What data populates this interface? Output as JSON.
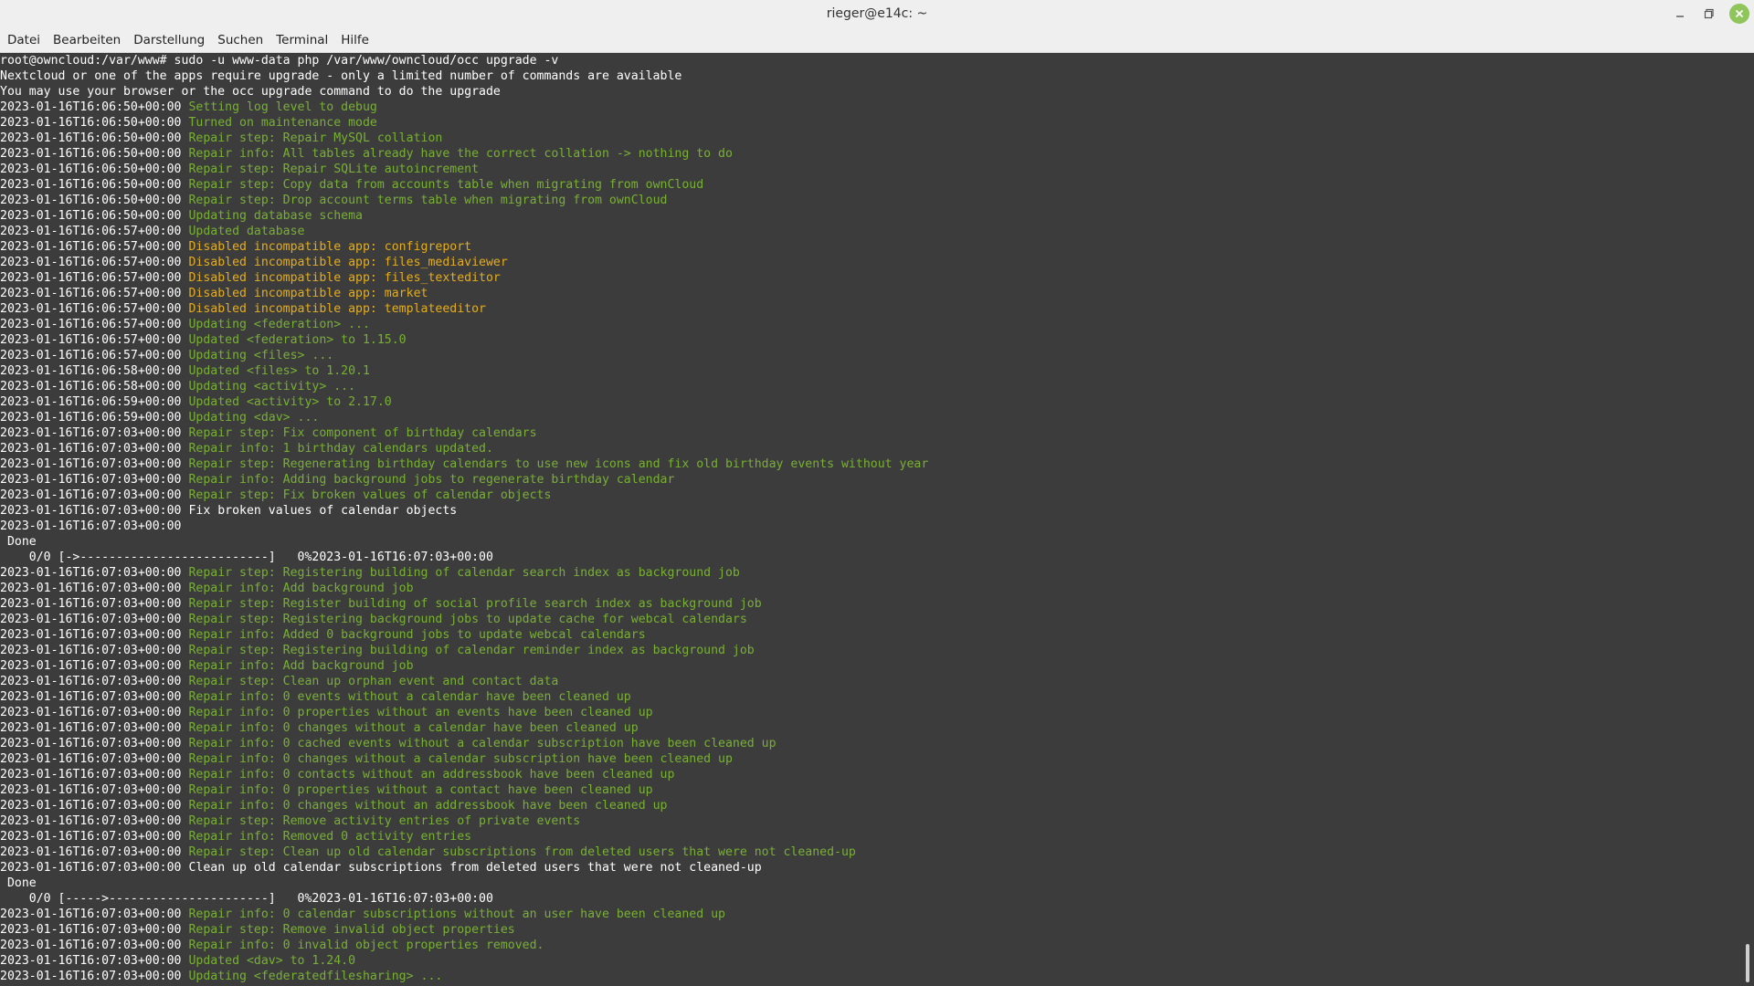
{
  "window": {
    "title": "rieger@e14c: ~",
    "controls": {
      "minimize_icon": "minimize-icon",
      "maximize_icon": "maximize-icon",
      "close_icon": "close-icon",
      "close_color": "#8fc55a"
    }
  },
  "menu": [
    "Datei",
    "Bearbeiten",
    "Darstellung",
    "Suchen",
    "Terminal",
    "Hilfe"
  ],
  "colors": {
    "background": "#3c3c3c",
    "info": "#78b034",
    "warning": "#e4ad1e",
    "text": "#ffffff"
  },
  "terminal": {
    "lines": [
      {
        "ts": "",
        "msg": "root@owncloud:/var/www# sudo -u www-data php /var/www/owncloud/occ upgrade -v",
        "color": "w"
      },
      {
        "ts": "",
        "msg": "Nextcloud or one of the apps require upgrade - only a limited number of commands are available",
        "color": "w"
      },
      {
        "ts": "",
        "msg": "You may use your browser or the occ upgrade command to do the upgrade",
        "color": "w"
      },
      {
        "ts": "2023-01-16T16:06:50+00:00 ",
        "msg": "Setting log level to debug",
        "color": "g"
      },
      {
        "ts": "2023-01-16T16:06:50+00:00 ",
        "msg": "Turned on maintenance mode",
        "color": "g"
      },
      {
        "ts": "2023-01-16T16:06:50+00:00 ",
        "msg": "Repair step: Repair MySQL collation",
        "color": "g"
      },
      {
        "ts": "2023-01-16T16:06:50+00:00 ",
        "msg": "Repair info: All tables already have the correct collation -> nothing to do",
        "color": "g"
      },
      {
        "ts": "2023-01-16T16:06:50+00:00 ",
        "msg": "Repair step: Repair SQLite autoincrement",
        "color": "g"
      },
      {
        "ts": "2023-01-16T16:06:50+00:00 ",
        "msg": "Repair step: Copy data from accounts table when migrating from ownCloud",
        "color": "g"
      },
      {
        "ts": "2023-01-16T16:06:50+00:00 ",
        "msg": "Repair step: Drop account terms table when migrating from ownCloud",
        "color": "g"
      },
      {
        "ts": "2023-01-16T16:06:50+00:00 ",
        "msg": "Updating database schema",
        "color": "g"
      },
      {
        "ts": "2023-01-16T16:06:57+00:00 ",
        "msg": "Updated database",
        "color": "g"
      },
      {
        "ts": "2023-01-16T16:06:57+00:00 ",
        "msg": "Disabled incompatible app: configreport",
        "color": "y"
      },
      {
        "ts": "2023-01-16T16:06:57+00:00 ",
        "msg": "Disabled incompatible app: files_mediaviewer",
        "color": "y"
      },
      {
        "ts": "2023-01-16T16:06:57+00:00 ",
        "msg": "Disabled incompatible app: files_texteditor",
        "color": "y"
      },
      {
        "ts": "2023-01-16T16:06:57+00:00 ",
        "msg": "Disabled incompatible app: market",
        "color": "y"
      },
      {
        "ts": "2023-01-16T16:06:57+00:00 ",
        "msg": "Disabled incompatible app: templateeditor",
        "color": "y"
      },
      {
        "ts": "2023-01-16T16:06:57+00:00 ",
        "msg": "Updating <federation> ...",
        "color": "g"
      },
      {
        "ts": "2023-01-16T16:06:57+00:00 ",
        "msg": "Updated <federation> to 1.15.0",
        "color": "g"
      },
      {
        "ts": "2023-01-16T16:06:57+00:00 ",
        "msg": "Updating <files> ...",
        "color": "g"
      },
      {
        "ts": "2023-01-16T16:06:58+00:00 ",
        "msg": "Updated <files> to 1.20.1",
        "color": "g"
      },
      {
        "ts": "2023-01-16T16:06:58+00:00 ",
        "msg": "Updating <activity> ...",
        "color": "g"
      },
      {
        "ts": "2023-01-16T16:06:59+00:00 ",
        "msg": "Updated <activity> to 2.17.0",
        "color": "g"
      },
      {
        "ts": "2023-01-16T16:06:59+00:00 ",
        "msg": "Updating <dav> ...",
        "color": "g"
      },
      {
        "ts": "2023-01-16T16:07:03+00:00 ",
        "msg": "Repair step: Fix component of birthday calendars",
        "color": "g"
      },
      {
        "ts": "2023-01-16T16:07:03+00:00 ",
        "msg": "Repair info: 1 birthday calendars updated.",
        "color": "g"
      },
      {
        "ts": "2023-01-16T16:07:03+00:00 ",
        "msg": "Repair step: Regenerating birthday calendars to use new icons and fix old birthday events without year",
        "color": "g"
      },
      {
        "ts": "2023-01-16T16:07:03+00:00 ",
        "msg": "Repair info: Adding background jobs to regenerate birthday calendar",
        "color": "g"
      },
      {
        "ts": "2023-01-16T16:07:03+00:00 ",
        "msg": "Repair step: Fix broken values of calendar objects",
        "color": "g"
      },
      {
        "ts": "2023-01-16T16:07:03+00:00 ",
        "msg": "Fix broken values of calendar objects",
        "color": "w"
      },
      {
        "ts": "2023-01-16T16:07:03+00:00 ",
        "msg": "",
        "color": "w"
      },
      {
        "ts": "",
        "msg": " Done",
        "color": "w"
      },
      {
        "ts": "",
        "msg": "    0/0 [->--------------------------]   0%2023-01-16T16:07:03+00:00",
        "color": "w"
      },
      {
        "ts": "2023-01-16T16:07:03+00:00 ",
        "msg": "Repair step: Registering building of calendar search index as background job",
        "color": "g"
      },
      {
        "ts": "2023-01-16T16:07:03+00:00 ",
        "msg": "Repair info: Add background job",
        "color": "g"
      },
      {
        "ts": "2023-01-16T16:07:03+00:00 ",
        "msg": "Repair step: Register building of social profile search index as background job",
        "color": "g"
      },
      {
        "ts": "2023-01-16T16:07:03+00:00 ",
        "msg": "Repair step: Registering background jobs to update cache for webcal calendars",
        "color": "g"
      },
      {
        "ts": "2023-01-16T16:07:03+00:00 ",
        "msg": "Repair info: Added 0 background jobs to update webcal calendars",
        "color": "g"
      },
      {
        "ts": "2023-01-16T16:07:03+00:00 ",
        "msg": "Repair step: Registering building of calendar reminder index as background job",
        "color": "g"
      },
      {
        "ts": "2023-01-16T16:07:03+00:00 ",
        "msg": "Repair info: Add background job",
        "color": "g"
      },
      {
        "ts": "2023-01-16T16:07:03+00:00 ",
        "msg": "Repair step: Clean up orphan event and contact data",
        "color": "g"
      },
      {
        "ts": "2023-01-16T16:07:03+00:00 ",
        "msg": "Repair info: 0 events without a calendar have been cleaned up",
        "color": "g"
      },
      {
        "ts": "2023-01-16T16:07:03+00:00 ",
        "msg": "Repair info: 0 properties without an events have been cleaned up",
        "color": "g"
      },
      {
        "ts": "2023-01-16T16:07:03+00:00 ",
        "msg": "Repair info: 0 changes without a calendar have been cleaned up",
        "color": "g"
      },
      {
        "ts": "2023-01-16T16:07:03+00:00 ",
        "msg": "Repair info: 0 cached events without a calendar subscription have been cleaned up",
        "color": "g"
      },
      {
        "ts": "2023-01-16T16:07:03+00:00 ",
        "msg": "Repair info: 0 changes without a calendar subscription have been cleaned up",
        "color": "g"
      },
      {
        "ts": "2023-01-16T16:07:03+00:00 ",
        "msg": "Repair info: 0 contacts without an addressbook have been cleaned up",
        "color": "g"
      },
      {
        "ts": "2023-01-16T16:07:03+00:00 ",
        "msg": "Repair info: 0 properties without a contact have been cleaned up",
        "color": "g"
      },
      {
        "ts": "2023-01-16T16:07:03+00:00 ",
        "msg": "Repair info: 0 changes without an addressbook have been cleaned up",
        "color": "g"
      },
      {
        "ts": "2023-01-16T16:07:03+00:00 ",
        "msg": "Repair step: Remove activity entries of private events",
        "color": "g"
      },
      {
        "ts": "2023-01-16T16:07:03+00:00 ",
        "msg": "Repair info: Removed 0 activity entries",
        "color": "g"
      },
      {
        "ts": "2023-01-16T16:07:03+00:00 ",
        "msg": "Repair step: Clean up old calendar subscriptions from deleted users that were not cleaned-up",
        "color": "g"
      },
      {
        "ts": "2023-01-16T16:07:03+00:00 ",
        "msg": "Clean up old calendar subscriptions from deleted users that were not cleaned-up",
        "color": "w"
      },
      {
        "ts": "",
        "msg": " Done",
        "color": "w"
      },
      {
        "ts": "",
        "msg": "    0/0 [----->----------------------]   0%2023-01-16T16:07:03+00:00",
        "color": "w"
      },
      {
        "ts": "2023-01-16T16:07:03+00:00 ",
        "msg": "Repair info: 0 calendar subscriptions without an user have been cleaned up",
        "color": "g"
      },
      {
        "ts": "2023-01-16T16:07:03+00:00 ",
        "msg": "Repair step: Remove invalid object properties",
        "color": "g"
      },
      {
        "ts": "2023-01-16T16:07:03+00:00 ",
        "msg": "Repair info: 0 invalid object properties removed.",
        "color": "g"
      },
      {
        "ts": "2023-01-16T16:07:03+00:00 ",
        "msg": "Updated <dav> to 1.24.0",
        "color": "g"
      },
      {
        "ts": "2023-01-16T16:07:03+00:00 ",
        "msg": "Updating <federatedfilesharing> ...",
        "color": "g"
      }
    ]
  }
}
